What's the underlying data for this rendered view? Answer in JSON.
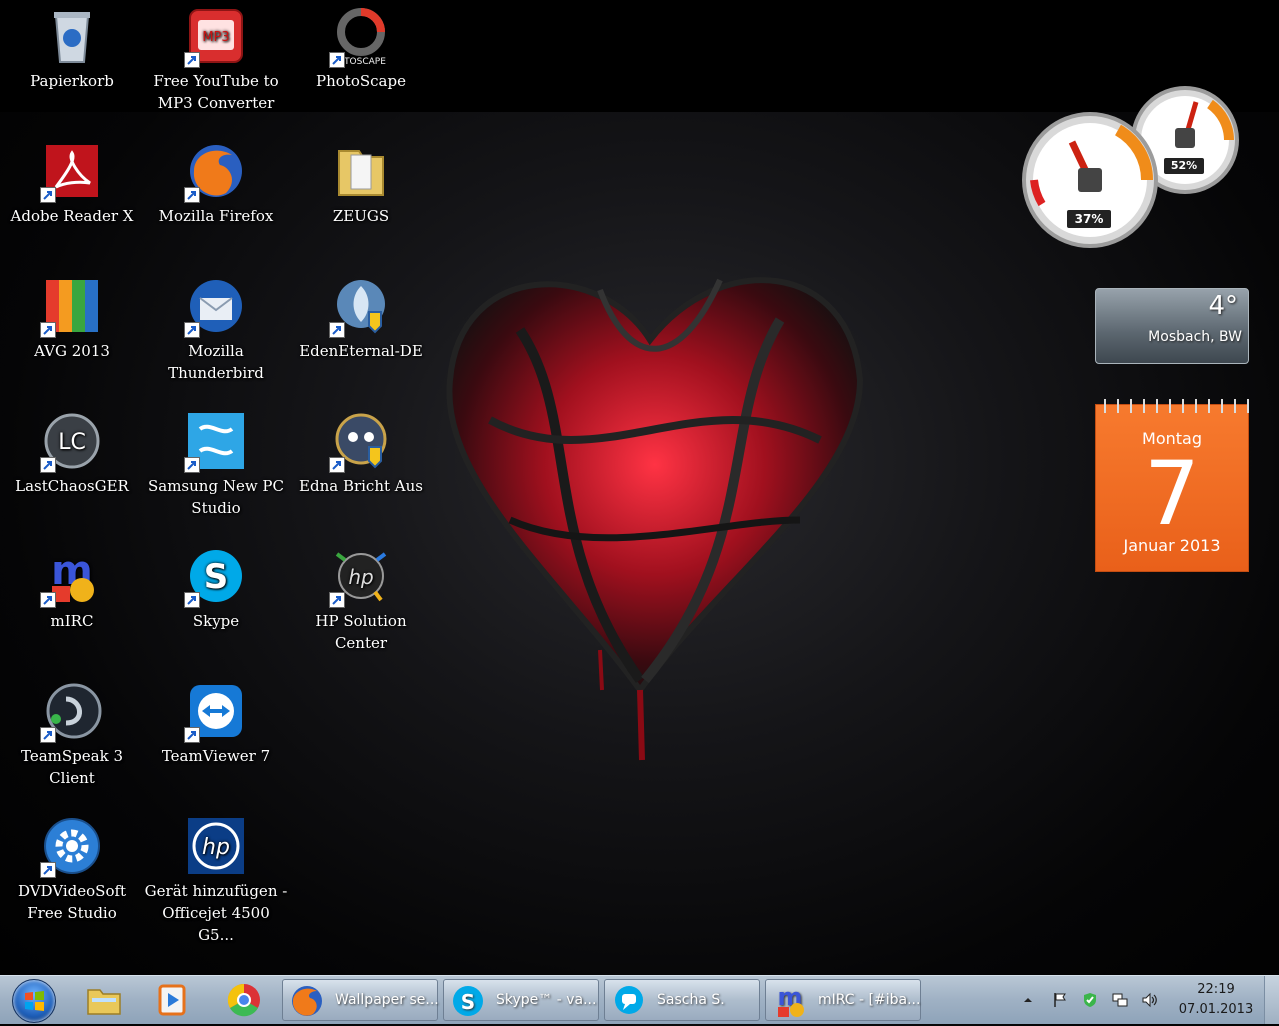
{
  "desktop": {
    "icons": [
      {
        "label": "Papierkorb"
      },
      {
        "label": "Free YouTube to MP3 Converter",
        "badge": "MP3"
      },
      {
        "label": "PhotoScape",
        "badge": "TOSCAPE"
      },
      {
        "label": "Adobe Reader X"
      },
      {
        "label": "Mozilla Firefox"
      },
      {
        "label": "ZEUGS"
      },
      {
        "label": "AVG 2013"
      },
      {
        "label": "Mozilla Thunderbird"
      },
      {
        "label": "EdenEternal-DE"
      },
      {
        "label": "LastChaosGER"
      },
      {
        "label": "Samsung New PC Studio"
      },
      {
        "label": "Edna Bricht Aus"
      },
      {
        "label": "mIRC"
      },
      {
        "label": "Skype"
      },
      {
        "label": "HP Solution Center"
      },
      {
        "label": "TeamSpeak 3 Client"
      },
      {
        "label": "TeamViewer 7"
      },
      {
        "label": "DVDVideoSoft Free Studio"
      },
      {
        "label": "Gerät hinzufügen - Officejet 4500 G5..."
      }
    ]
  },
  "gadgets": {
    "meter": {
      "cpu": "37%",
      "ram": "52%"
    },
    "weather": {
      "temperature": "4°",
      "location": "Mosbach, BW"
    },
    "calendar": {
      "weekday": "Montag",
      "day": "7",
      "month_year": "Januar 2013"
    }
  },
  "taskbar": {
    "tasks": [
      {
        "label": "Wallpaper se..."
      },
      {
        "label": "Skype™ - va..."
      },
      {
        "label": "Sascha S."
      },
      {
        "label": "mIRC - [#iba..."
      }
    ],
    "clock": {
      "time": "22:19",
      "date": "07.01.2013"
    }
  },
  "colors": {
    "calendar": "#f06b24",
    "taskbar": "#a9bacb",
    "heart": "#c0182a"
  }
}
